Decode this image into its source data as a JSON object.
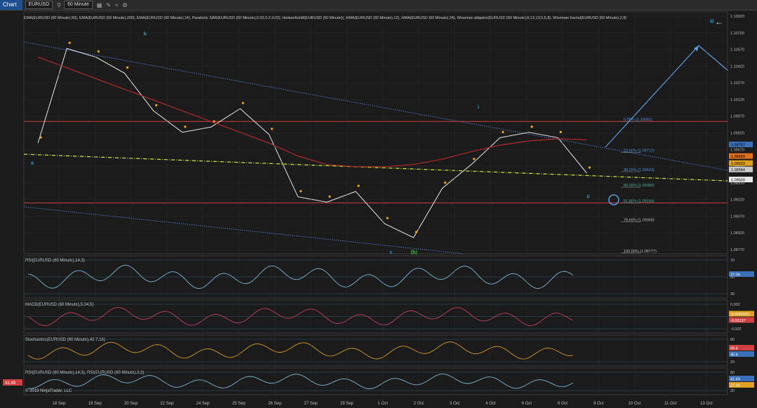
{
  "toolbar": {
    "title": "Chart",
    "instrument": "EURUSD",
    "timeframe": "60 Minute"
  },
  "header_text": "EMA(EURUSD (60 Minute),50), EMA(EURUSD (60 Minute),200), EMA(EURUSD (60 Minute),14), Parabolic SAR(EURUSD (60 Minute),0.02,0.2,0.02), HeikenAshi8(EURUSD (60 Minute)), HMA(EURUSD (60 Minute),12), HMA(EURUSD (60 Minute),34), Wiseman alligator(EURUSD (60 Minute),8,13,13,5,5,8), Wiseman fractal(EURUSD (60 Minute),2,8)",
  "copyright": "© 2019 NinjaTrader, LLC",
  "colors": {
    "bg": "#1b1b1b",
    "grid": "#2c2c2c",
    "ema200": "#b22a2a",
    "ema50": "#3a6fd1",
    "sar": "#f5a623",
    "fib": "#d6ef3a",
    "rsi": "#7ab8d6",
    "axis_text": "#bdbdbd"
  },
  "chart_data": [
    {
      "type": "line",
      "title": "EURUSD (60 Minute)",
      "x_labels": [
        "18 Sep",
        "19 Sep",
        "20 Sep",
        "22 Sep",
        "24 Sep",
        "25 Sep",
        "26 Sep",
        "27 Sep",
        "29 Sep",
        "1 Oct",
        "2 Oct",
        "3 Oct",
        "4 Oct",
        "6 Oct",
        "8 Oct",
        "9 Oct",
        "10 Oct",
        "11 Oct",
        "13 Oct"
      ],
      "ylim": [
        1.0877,
        1.1102
      ],
      "y_ticks": [
        "1.10920",
        "1.10720",
        "1.10570",
        "1.10420",
        "1.10270",
        "1.10120",
        "1.09970",
        "1.09820",
        "1.09670",
        "1.09520",
        "1.09370",
        "1.09220",
        "1.09070",
        "1.08920",
        "1.08770"
      ],
      "series": [
        {
          "values": [
            1.098,
            1.1068,
            1.106,
            1.1045,
            1.101,
            1.099,
            1.0995,
            1.1012,
            1.0988,
            1.093,
            1.0925,
            1.0935,
            1.0905,
            1.0892,
            1.0938,
            1.096,
            1.0985,
            1.099,
            1.0985,
            1.0952
          ]
        },
        {
          "values": [
            1.106,
            1.105,
            1.104,
            1.103,
            1.102,
            1.101,
            1.1,
            1.099,
            1.098,
            1.0968,
            1.096,
            1.0958,
            1.0958,
            1.096,
            1.0965,
            1.0972,
            1.0978,
            1.0982,
            1.0984,
            1.0983
          ]
        }
      ],
      "fib_levels": [
        {
          "label": "0.00% (1.10001)",
          "value": 1.10001
        },
        {
          "label": "23.60% (1.09712)",
          "value": 1.09712
        },
        {
          "label": "38.20% (1.09533)",
          "value": 1.09533
        },
        {
          "label": "50.00% (1.09389)",
          "value": 1.09389
        },
        {
          "label": "61.80% (1.09244)",
          "value": 1.09244
        },
        {
          "label": "78.60% (1.09068)",
          "value": 1.09068
        },
        {
          "label": "100.00% (1.08777)",
          "value": 1.08777
        }
      ],
      "price_tags": [
        {
          "label": "1.09787",
          "value": 1.09787,
          "color": "#3b6fb8"
        },
        {
          "label": "1.09689",
          "value": 1.09689,
          "color": "#e0701c"
        },
        {
          "label": "1.09633",
          "value": 1.09633,
          "color": "#e0a020"
        },
        {
          "label": "1.09584",
          "value": 1.09584,
          "color": "#cccccc"
        },
        {
          "label": "1.09500",
          "value": 1.095,
          "color": "#e8e8e8"
        }
      ],
      "wave_labels": [
        {
          "text": "a",
          "x": 0.01,
          "y": 1.096,
          "color": "#2a9fd6"
        },
        {
          "text": "b",
          "x": 0.17,
          "y": 1.108,
          "color": "#2a9fd6"
        },
        {
          "text": "c",
          "x": 0.52,
          "y": 1.0877,
          "color": "#2a9fd6"
        },
        {
          "text": "(b)",
          "x": 0.55,
          "y": 1.0877,
          "color": "#3cc23c"
        },
        {
          "text": "i",
          "x": 0.645,
          "y": 1.1012,
          "color": "#2a9fd6"
        },
        {
          "text": "ii",
          "x": 0.8,
          "y": 1.0929,
          "color": "#2a9fd6"
        },
        {
          "text": "iii",
          "x": 0.975,
          "y": 1.1092,
          "color": "#2a9fd6"
        }
      ]
    },
    {
      "type": "line",
      "title": "RSI(EURUSD (60 Minute),14,3)",
      "ylim": [
        20,
        75
      ],
      "y_ticks": [
        "70",
        "50",
        "30"
      ],
      "value_tag": "37.06"
    },
    {
      "type": "bar",
      "title": "MACD(EURUSD (60 Minute),5,34,5)",
      "y_ticks": [
        "0.002",
        "0",
        "-0.002"
      ],
      "value_tags": [
        "-0.0000261",
        "-0.00137"
      ]
    },
    {
      "type": "line",
      "title": "Stochastics(EURUSD (60 Minute),42,7,16)",
      "ylim": [
        0,
        100
      ],
      "y_ticks": [
        "80",
        "20"
      ],
      "value_tags": [
        "49.6",
        "45.6"
      ]
    },
    {
      "type": "line",
      "title": "RSI(EURUSD (60 Minute),14,3), RSI(EURUSD (60 Minute),3,3)",
      "ylim": [
        0,
        100
      ],
      "y_ticks": [
        "80",
        "20"
      ],
      "value_tags": [
        "41.49",
        "37.06"
      ]
    }
  ]
}
